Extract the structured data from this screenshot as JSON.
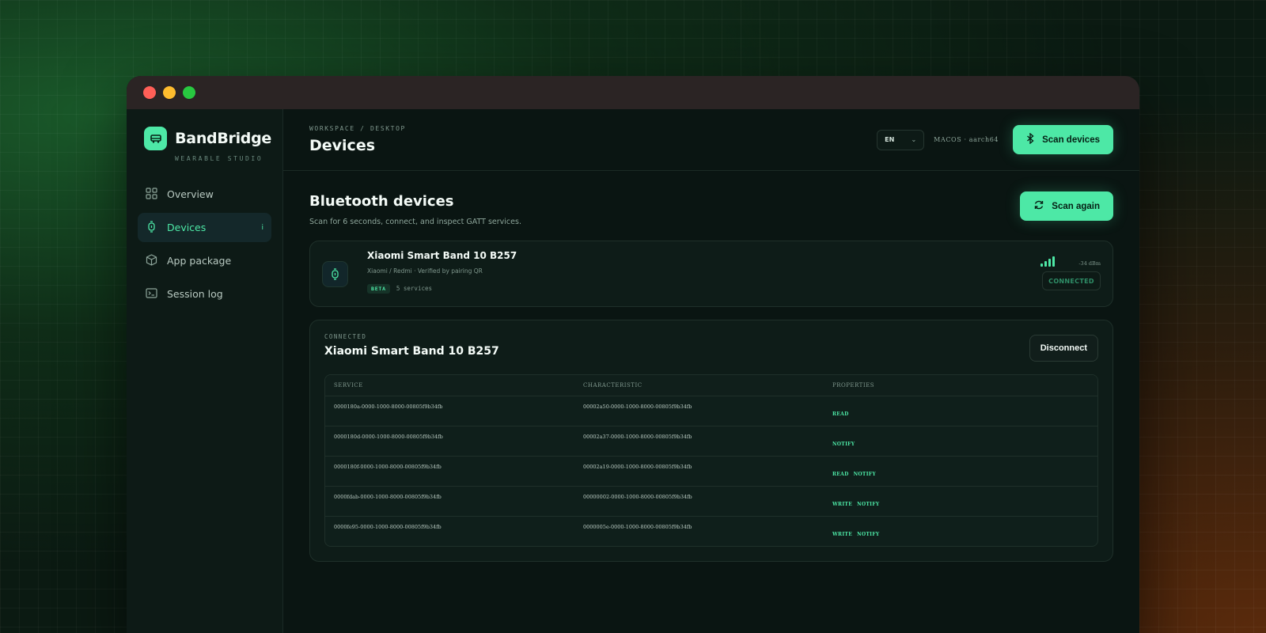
{
  "window": {
    "controls": [
      "close",
      "minimize",
      "zoom"
    ]
  },
  "sidebar": {
    "brand": {
      "name": "BandBridge",
      "subtitle": "WEARABLE STUDIO",
      "icon": "bus-icon"
    },
    "items": [
      {
        "label": "Overview",
        "icon": "grid-icon",
        "active": false
      },
      {
        "label": "Devices",
        "icon": "watch-icon",
        "active": true,
        "marker": "i"
      },
      {
        "label": "App package",
        "icon": "package-icon",
        "active": false
      },
      {
        "label": "Session log",
        "icon": "terminal-icon",
        "active": false
      }
    ]
  },
  "header": {
    "breadcrumb": "WORKSPACE / DESKTOP",
    "title": "Devices",
    "language": "EN",
    "platform": "MACOS · aarch64",
    "scan_button": "Scan devices"
  },
  "section": {
    "title": "Bluetooth devices",
    "description": "Scan for 6 seconds, connect, and inspect GATT services.",
    "scan_again": "Scan again"
  },
  "device": {
    "name": "Xiaomi Smart Band 10 B257",
    "meta": "Xiaomi / Redmi · Verified by pairing QR",
    "tag": "BETA",
    "services": "5 services",
    "signal": "-34 dBm",
    "signal_bars": 4,
    "status": "CONNECTED"
  },
  "connection": {
    "label": "CONNECTED",
    "name": "Xiaomi Smart Band 10 B257",
    "disconnect": "Disconnect",
    "columns": [
      "SERVICE",
      "CHARACTERISTIC",
      "PROPERTIES"
    ],
    "rows": [
      {
        "service": "0000180a-0000-1000-8000-00805f9b34fb",
        "characteristic": "00002a50-0000-1000-8000-00805f9b34fb",
        "props": [
          "READ"
        ]
      },
      {
        "service": "0000180d-0000-1000-8000-00805f9b34fb",
        "characteristic": "00002a37-0000-1000-8000-00805f9b34fb",
        "props": [
          "NOTIFY"
        ]
      },
      {
        "service": "0000180f-0000-1000-8000-00805f9b34fb",
        "characteristic": "00002a19-0000-1000-8000-00805f9b34fb",
        "props": [
          "READ",
          "NOTIFY"
        ]
      },
      {
        "service": "0000fdab-0000-1000-8000-00805f9b34fb",
        "characteristic": "00000002-0000-1000-8000-00805f9b34fb",
        "props": [
          "WRITE",
          "NOTIFY"
        ]
      },
      {
        "service": "0000fe95-0000-1000-8000-00805f9b34fb",
        "characteristic": "0000005e-0000-1000-8000-00805f9b34fb",
        "props": [
          "WRITE",
          "NOTIFY"
        ]
      }
    ]
  },
  "colors": {
    "accent": "#4de8a6",
    "panel": "#0e1c18",
    "titlebar": "#2b2424"
  }
}
